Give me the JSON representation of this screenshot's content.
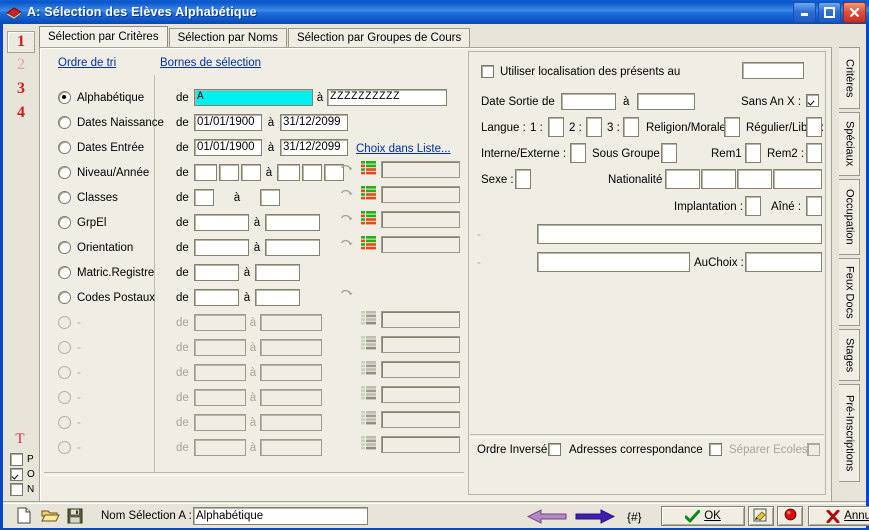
{
  "window": {
    "title": "A: Sélection des Elèves Alphabétique",
    "icon": "application-icon",
    "minimize": "–",
    "maximize": "□",
    "close": "✕"
  },
  "tabs": [
    {
      "label": "Sélection par Critères",
      "active": true
    },
    {
      "label": "Sélection par Noms",
      "active": false
    },
    {
      "label": "Sélection par Groupes de Cours",
      "active": false
    }
  ],
  "left_strip": {
    "numbers": [
      "1",
      "2",
      "3",
      "4"
    ],
    "selected_number": "1",
    "t_mark": "T",
    "checks": [
      {
        "label": "P",
        "checked": false
      },
      {
        "label": "O",
        "checked": true
      },
      {
        "label": "N",
        "checked": false
      }
    ]
  },
  "headers": {
    "sort_order": "Ordre de tri",
    "bounds": "Bornes de sélection",
    "choice_list": "Choix dans Liste...",
    "de": "de",
    "a": "à"
  },
  "criteria_rows": [
    {
      "label": "Alphabétique",
      "selected": true,
      "enabled": true,
      "kind": "wide",
      "from": "A",
      "to": "ZZZZZZZZZZ",
      "from_focus": true,
      "list": false
    },
    {
      "label": "Dates Naissance",
      "selected": false,
      "enabled": true,
      "kind": "date",
      "from": "01/01/1900",
      "to": "31/12/2099",
      "list": false
    },
    {
      "label": "Dates Entrée",
      "selected": false,
      "enabled": true,
      "kind": "date",
      "from": "01/01/1900",
      "to": "31/12/2099",
      "list": false
    },
    {
      "label": "Niveau/Année",
      "selected": false,
      "enabled": true,
      "kind": "triple",
      "from": "",
      "to": "",
      "list": true,
      "list_value": ""
    },
    {
      "label": "Classes",
      "selected": false,
      "enabled": true,
      "kind": "tiny",
      "from": "",
      "to": "",
      "list": true,
      "list_value": ""
    },
    {
      "label": "GrpEl",
      "selected": false,
      "enabled": true,
      "kind": "medium",
      "from": "",
      "to": "",
      "list": true,
      "list_value": ""
    },
    {
      "label": "Orientation",
      "selected": false,
      "enabled": true,
      "kind": "medium",
      "from": "",
      "to": "",
      "list": true,
      "list_value": ""
    },
    {
      "label": "Matric.Registre",
      "selected": false,
      "enabled": true,
      "kind": "small",
      "from": "",
      "to": "",
      "list": false
    },
    {
      "label": "Codes Postaux",
      "selected": false,
      "enabled": true,
      "kind": "small",
      "from": "",
      "to": "",
      "list": false
    },
    {
      "label": "-",
      "selected": false,
      "enabled": false,
      "kind": "small",
      "from": "",
      "to": "",
      "list": true,
      "list_value": ""
    },
    {
      "label": "-",
      "selected": false,
      "enabled": false,
      "kind": "small",
      "from": "",
      "to": "",
      "list": true,
      "list_value": ""
    },
    {
      "label": "-",
      "selected": false,
      "enabled": false,
      "kind": "small",
      "from": "",
      "to": "",
      "list": true,
      "list_value": ""
    },
    {
      "label": "-",
      "selected": false,
      "enabled": false,
      "kind": "small",
      "from": "",
      "to": "",
      "list": true,
      "list_value": ""
    },
    {
      "label": "-",
      "selected": false,
      "enabled": false,
      "kind": "small",
      "from": "",
      "to": "",
      "list": true,
      "list_value": ""
    },
    {
      "label": "-",
      "selected": false,
      "enabled": false,
      "kind": "small",
      "from": "",
      "to": "",
      "list": true,
      "list_value": ""
    }
  ],
  "right_pane": {
    "use_localisation": {
      "label": "Utiliser localisation des présents au",
      "checked": false,
      "value": ""
    },
    "date_sortie": {
      "label": "Date Sortie :",
      "de": "de",
      "a": "à",
      "from": "",
      "to": ""
    },
    "sans_an_x": {
      "label": "Sans An X :",
      "checked": true
    },
    "langue": {
      "label": "Langue :",
      "n1": "1 :",
      "n2": "2 :",
      "n3": "3 :",
      "v1": "",
      "v2": "",
      "v3": ""
    },
    "religion": {
      "label": "Religion/Morale :",
      "value": ""
    },
    "regulier": {
      "label": "Régulier/Libre :",
      "value": ""
    },
    "interne_externe": {
      "label": "Interne/Externe :",
      "value": ""
    },
    "sous_groupe": {
      "label": "Sous Groupe :",
      "value": ""
    },
    "rem1": {
      "label": "Rem1 :",
      "value": ""
    },
    "rem2": {
      "label": "Rem2 :",
      "value": ""
    },
    "sexe": {
      "label": "Sexe :",
      "value": ""
    },
    "nationalite": {
      "label": "Nationalité :",
      "values": [
        "",
        "",
        "",
        ""
      ]
    },
    "implantation": {
      "label": "Implantation :",
      "value": ""
    },
    "aine": {
      "label": "Aîné :",
      "value": ""
    },
    "extra1": {
      "label": "-",
      "value": ""
    },
    "extra2": {
      "label": "-",
      "value": ""
    },
    "auchoix": {
      "label": "AuChoix :",
      "value": ""
    },
    "ordre_inverse": {
      "label": "Ordre Inversé",
      "checked": false,
      "enabled": true
    },
    "adresses_corr": {
      "label": "Adresses correspondance",
      "checked": false,
      "enabled": true
    },
    "separer_ecoles": {
      "label": "Séparer Ecoles",
      "checked": false,
      "enabled": false
    }
  },
  "vertical_tabs": [
    {
      "label": "Critères",
      "height": 62
    },
    {
      "label": "Spéciaux",
      "height": 64
    },
    {
      "label": "Occupation",
      "height": 76
    },
    {
      "label": "Feux Docs",
      "height": 68
    },
    {
      "label": "Stages",
      "height": 52
    },
    {
      "label": "Pré-Inscriptions",
      "height": 98
    }
  ],
  "toolbar": {
    "new_icon": "new-document-icon",
    "open_icon": "open-folder-icon",
    "save_icon": "save-disk-icon",
    "selection_label": "Nom Sélection A :",
    "selection_value": "Alphabétique",
    "prev_icon": "arrow-left-icon",
    "next_icon": "arrow-right-icon",
    "hash_label": "{#}",
    "ok_label": "OK",
    "ok_accel": "O",
    "print_icon": "print-preview-icon",
    "stop_icon": "stop-red-icon",
    "cancel_label": "Annuler",
    "cancel_accel": "A"
  },
  "colors": {
    "window_bg": "#E7E4DA",
    "panel_bg": "#EFEDE4",
    "accent_blue": "#0A46C8",
    "link": "#00309C",
    "red_number": "#D02020",
    "focus_field": "#00F0F0"
  }
}
